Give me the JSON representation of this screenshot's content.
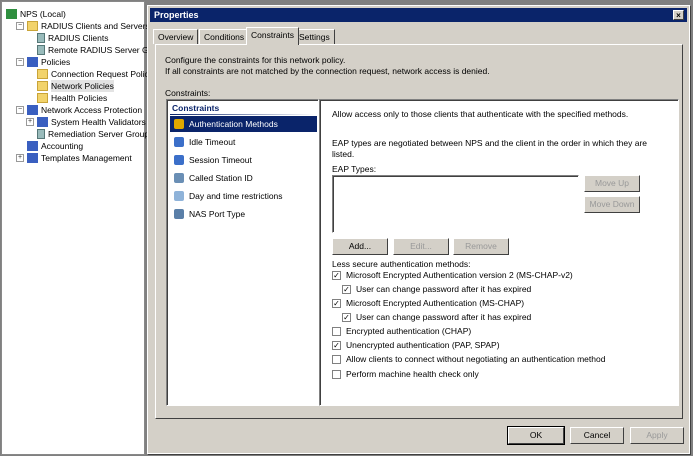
{
  "tree": [
    {
      "label": "NPS (Local)",
      "level": 0,
      "icon": "nps-icon"
    },
    {
      "label": "RADIUS Clients and Servers",
      "level": 1,
      "icon": "folder-icon",
      "expander": "−"
    },
    {
      "label": "RADIUS Clients",
      "level": 2,
      "icon": "server-icon"
    },
    {
      "label": "Remote RADIUS Server G",
      "level": 2,
      "icon": "server-group-icon"
    },
    {
      "label": "Policies",
      "level": 1,
      "icon": "policies-icon",
      "expander": "−"
    },
    {
      "label": "Connection Request Polici",
      "level": 2,
      "icon": "folder-icon"
    },
    {
      "label": "Network Policies",
      "level": 2,
      "icon": "folder-open-icon",
      "selected": true
    },
    {
      "label": "Health Policies",
      "level": 2,
      "icon": "folder-icon"
    },
    {
      "label": "Network Access Protection",
      "level": 1,
      "icon": "nap-icon",
      "expander": "−"
    },
    {
      "label": "System Health Validators",
      "level": 2,
      "icon": "validator-icon",
      "expander": "+"
    },
    {
      "label": "Remediation Server Group",
      "level": 2,
      "icon": "server-group-icon"
    },
    {
      "label": "Accounting",
      "level": 1,
      "icon": "accounting-icon"
    },
    {
      "label": "Templates Management",
      "level": 1,
      "icon": "templates-icon",
      "expander": "+"
    }
  ],
  "dialog": {
    "title": "Properties",
    "tabs": [
      "Overview",
      "Conditions",
      "Constraints",
      "Settings"
    ],
    "active_tab": "Constraints",
    "desc1": "Configure the constraints for this network policy.",
    "desc2": "If all constraints are not matched by the connection request, network access is denied.",
    "constraints_label": "Constraints:",
    "list_header": "Constraints",
    "list": [
      {
        "label": "Authentication Methods",
        "icon": "lock-icon",
        "color": "#e0a800",
        "selected": true
      },
      {
        "label": "Idle Timeout",
        "icon": "idle-timeout-icon",
        "color": "#3b6fc9"
      },
      {
        "label": "Session Timeout",
        "icon": "session-timeout-icon",
        "color": "#3b6fc9"
      },
      {
        "label": "Called Station ID",
        "icon": "station-id-icon",
        "color": "#6a8fb5"
      },
      {
        "label": "Day and time restrictions",
        "icon": "clock-icon",
        "color": "#8fb3d9"
      },
      {
        "label": "NAS Port Type",
        "icon": "nas-port-icon",
        "color": "#5a7fa8"
      }
    ],
    "right": {
      "allow_text": "Allow access only to those clients that authenticate with the specified methods.",
      "eap_text1": "EAP types are negotiated between NPS and the client in the order in which they are",
      "eap_text2": "listed.",
      "eap_types_label": "EAP Types:",
      "move_up": "Move Up",
      "move_down": "Move Down",
      "add": "Add...",
      "edit": "Edit...",
      "remove": "Remove",
      "less_secure_label": "Less secure authentication methods:",
      "checks": [
        {
          "label": "Microsoft Encrypted Authentication version 2 (MS-CHAP-v2)",
          "checked": true,
          "indent": false
        },
        {
          "label": "User can change password after it has expired",
          "checked": true,
          "indent": true
        },
        {
          "label": "Microsoft Encrypted Authentication (MS-CHAP)",
          "checked": true,
          "indent": false
        },
        {
          "label": "User can change password after it has expired",
          "checked": true,
          "indent": true
        },
        {
          "label": "Encrypted authentication (CHAP)",
          "checked": false,
          "indent": false
        },
        {
          "label": "Unencrypted authentication (PAP, SPAP)",
          "checked": true,
          "indent": false
        },
        {
          "label": "Allow clients to connect without negotiating an authentication method",
          "checked": false,
          "indent": false
        },
        {
          "label": "Perform machine health check only",
          "checked": false,
          "indent": false
        }
      ]
    },
    "ok": "OK",
    "cancel": "Cancel",
    "apply": "Apply",
    "close": "×"
  }
}
